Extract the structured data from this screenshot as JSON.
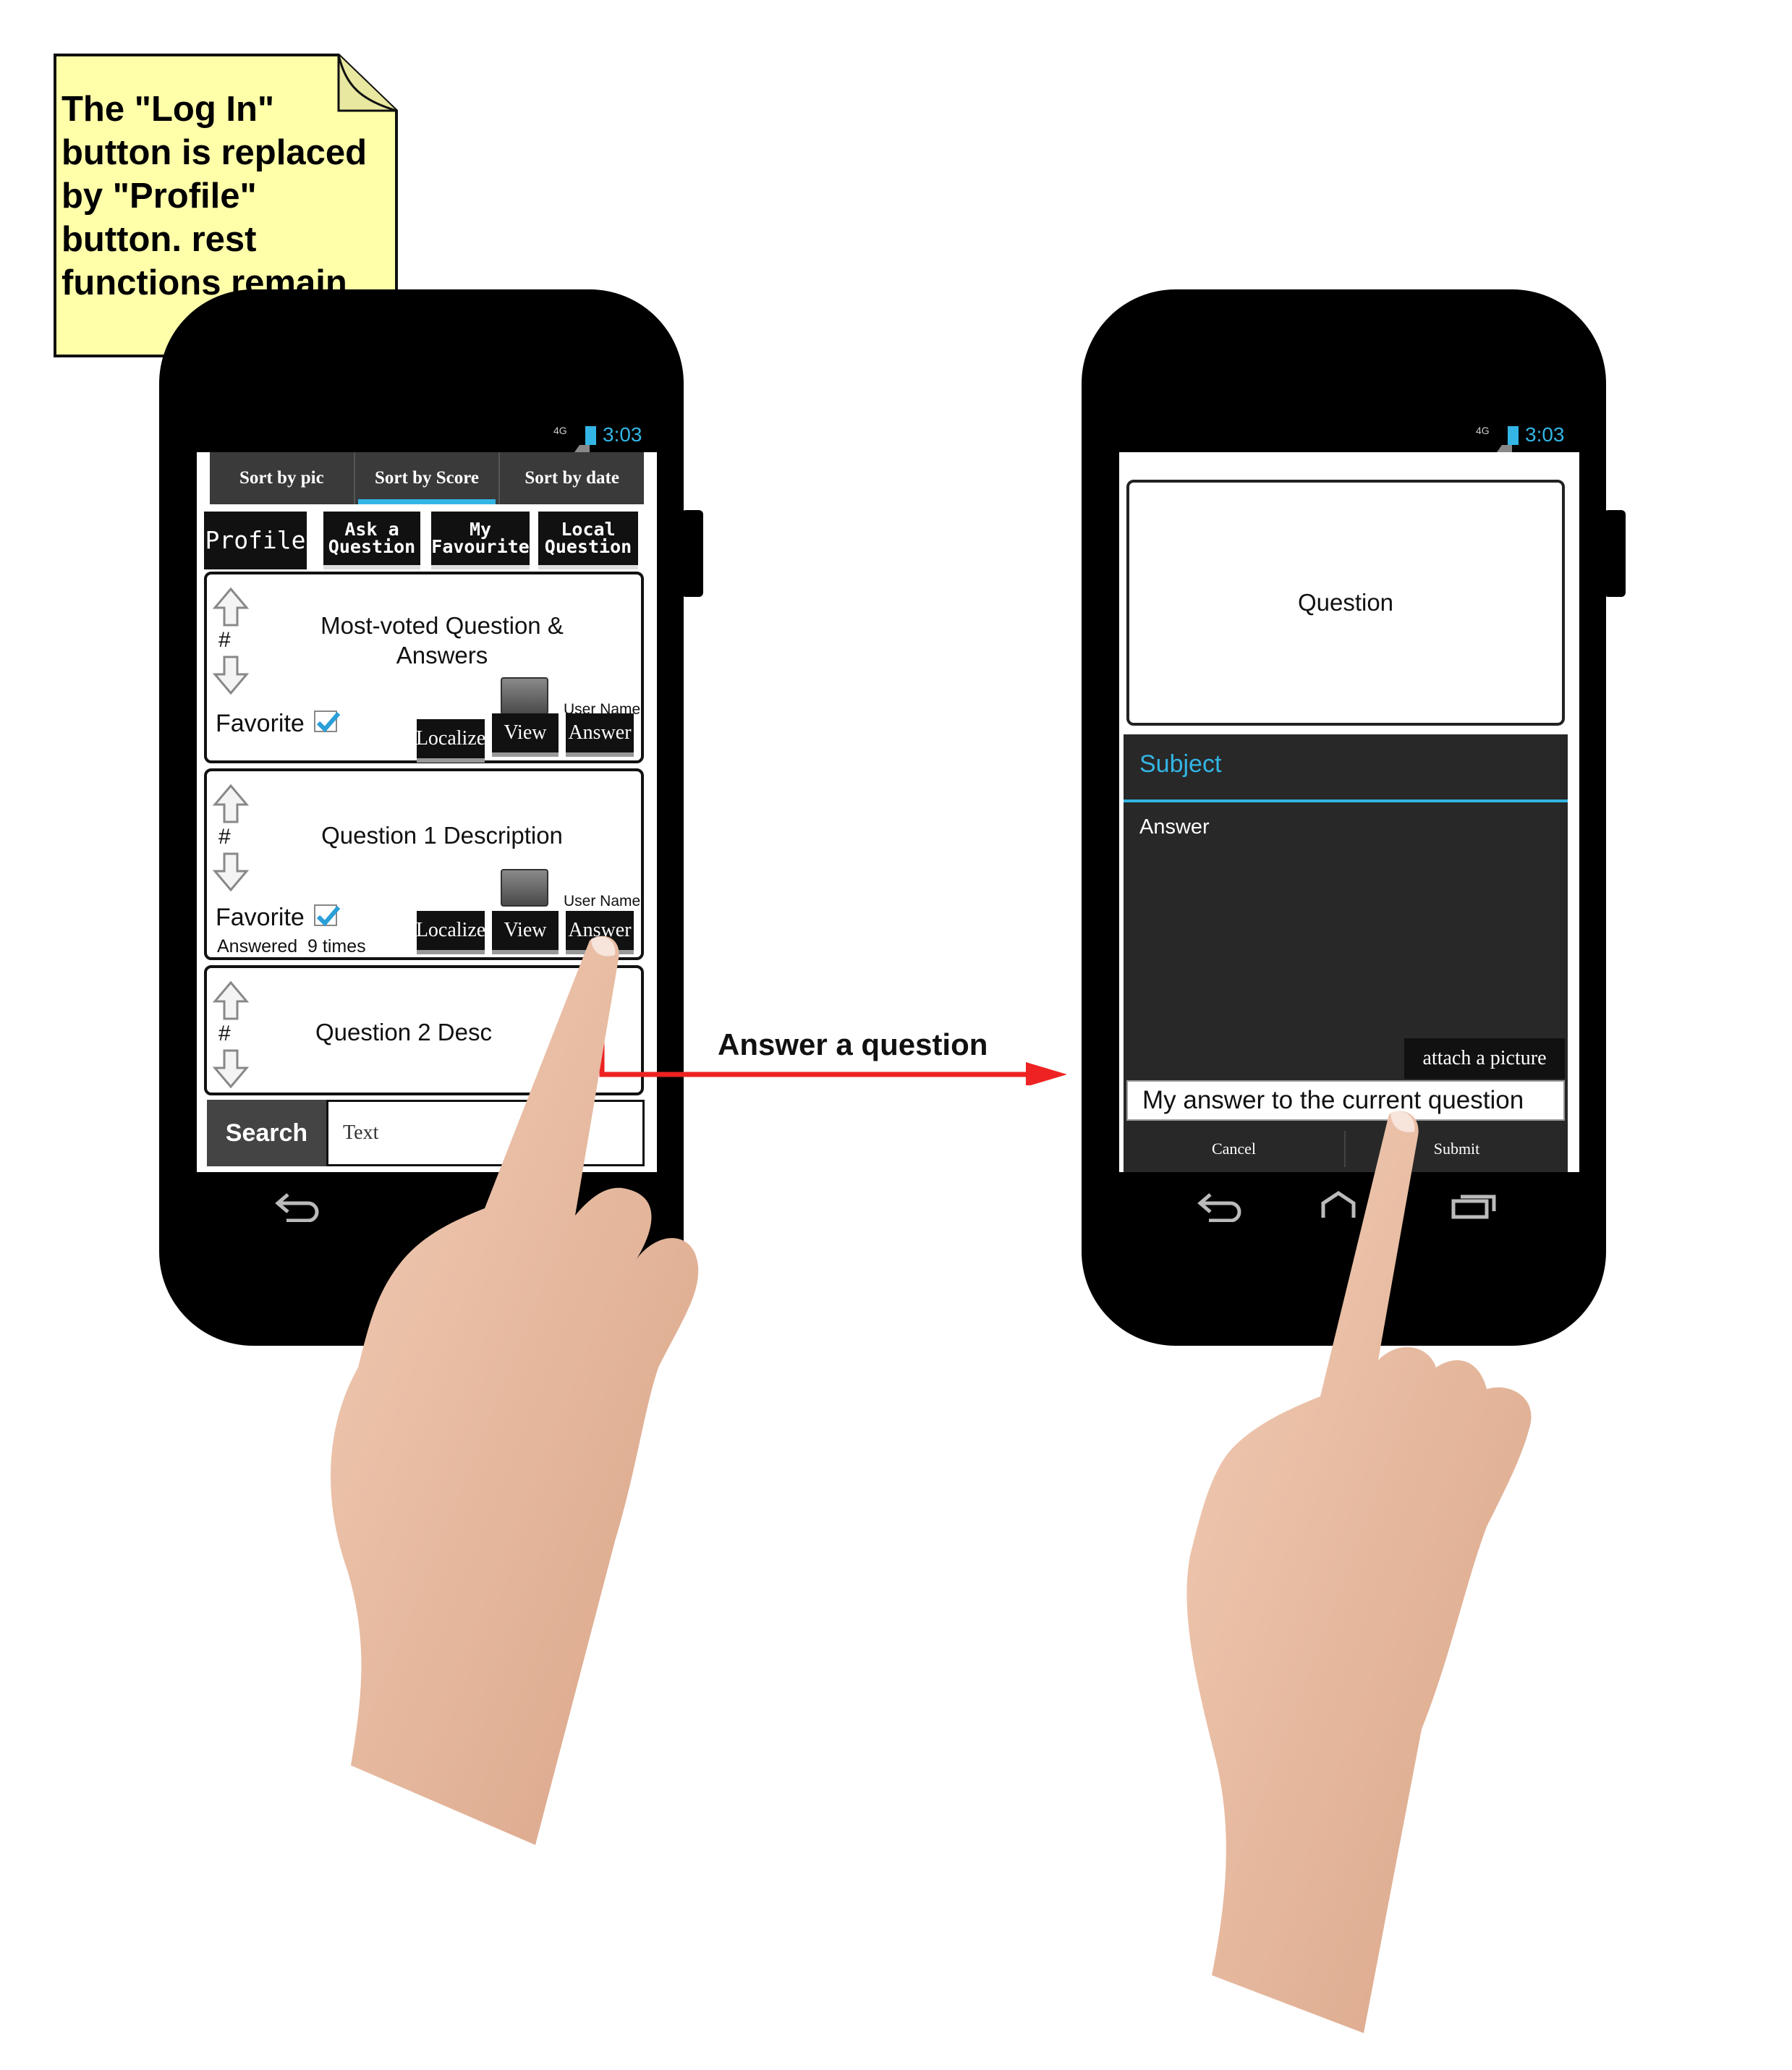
{
  "annotation": {
    "note": "The \"Log In\"\nbutton is replaced\nby \"Profile\"\nbutton. rest\nfunctions remain",
    "arrow_label": "Answer a question"
  },
  "left_phone": {
    "status_time": "3:03",
    "status_network": "4G",
    "sort_tabs": [
      "Sort by pic",
      "Sort by Score",
      "Sort by date"
    ],
    "active_sort": "Sort by Score",
    "top_buttons": {
      "profile": "Profile",
      "ask": "Ask a\nQuestion",
      "favourite": "My\nFavourite",
      "local": "Local\nQuestion"
    },
    "cards": [
      {
        "vote_symbol": "#",
        "title": "Most-voted Question &\nAnswers",
        "favorite_label": "Favorite",
        "user_name": "User Name",
        "localize": "Localize",
        "view": "View",
        "answer": "Answer"
      },
      {
        "vote_symbol": "#",
        "title": "Question 1 Description",
        "favorite_label": "Favorite",
        "user_name": "User Name",
        "answered": "Answered  9 times",
        "localize": "Localize",
        "view": "View",
        "answer": "Answer"
      },
      {
        "vote_symbol": "#",
        "title": "Question 2 Desc"
      }
    ],
    "search_label": "Search",
    "search_placeholder": "Text"
  },
  "right_phone": {
    "status_time": "3:03",
    "status_network": "4G",
    "question_label": "Question",
    "subject_label": "Subject",
    "answer_label": "Answer",
    "attach_label": "attach a picture",
    "answer_value": "My answer to the current question",
    "cancel_label": "Cancel",
    "submit_label": "Submit"
  },
  "colors": {
    "accent": "#33b5e5",
    "note_fill": "#ffffaa",
    "arrow": "#ee2222",
    "dialog_bg": "#282828"
  }
}
